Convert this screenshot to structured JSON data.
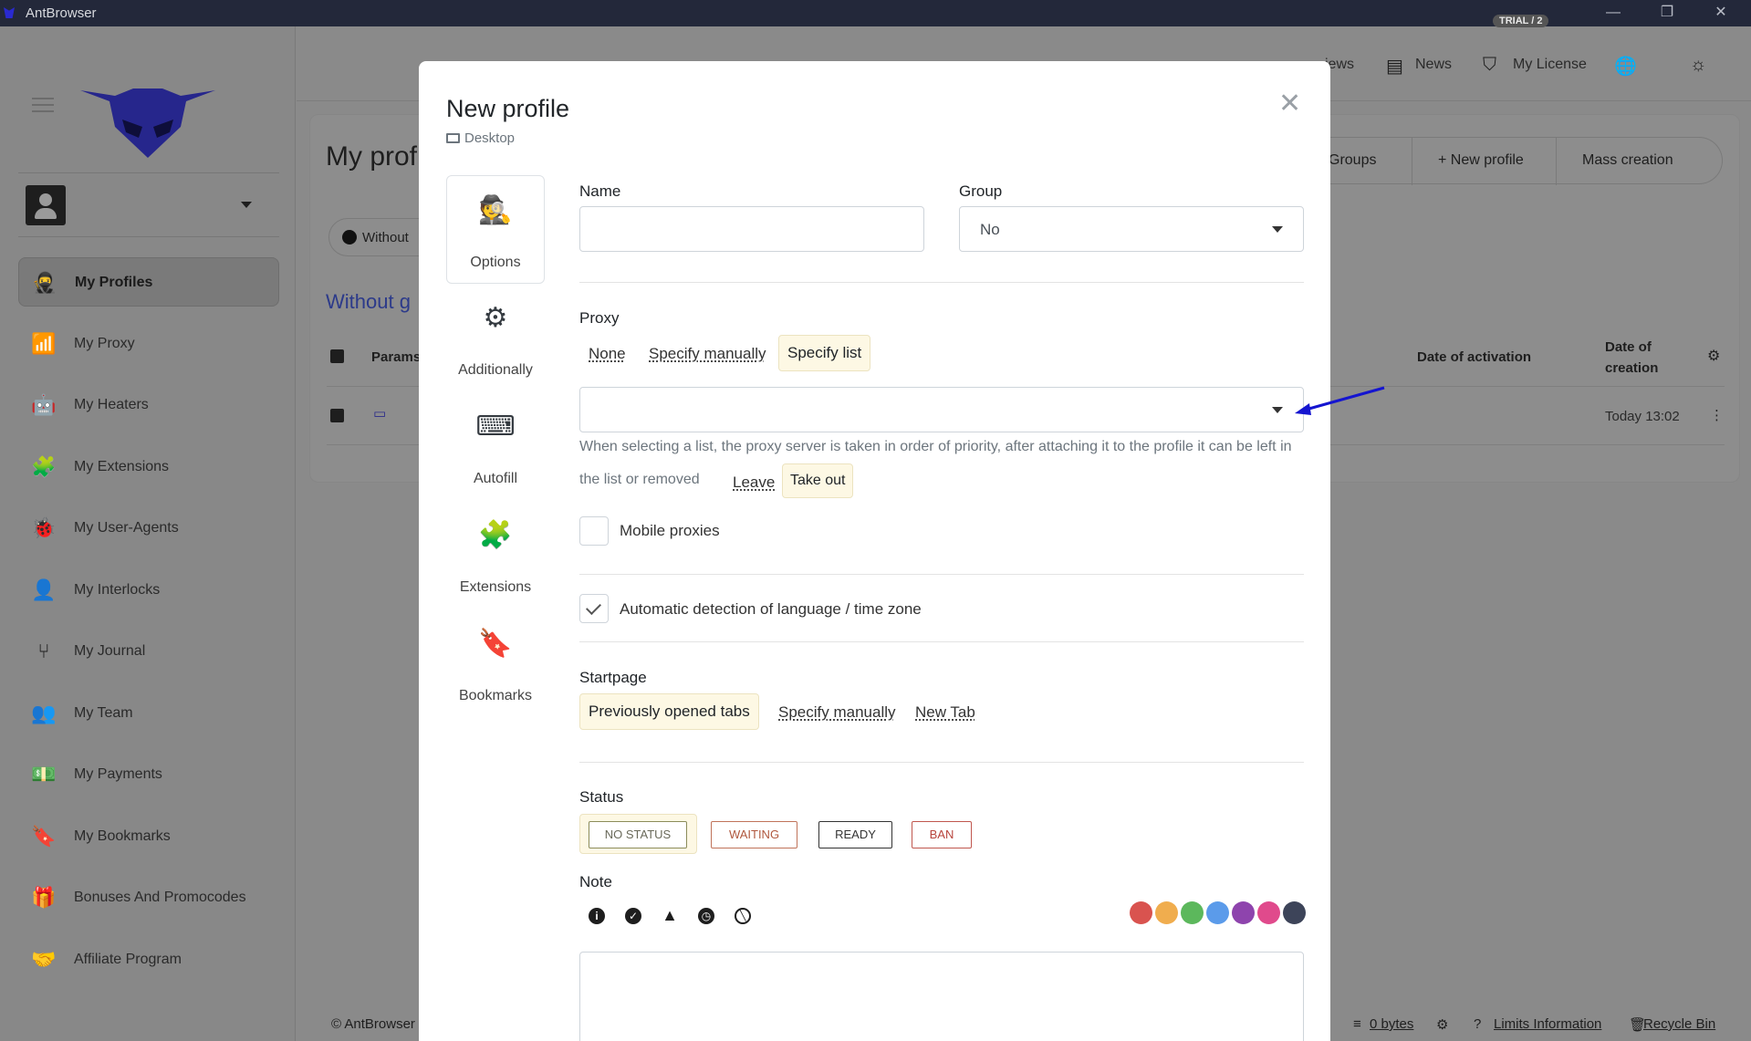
{
  "window": {
    "title": "AntBrowser",
    "minimize": "—",
    "restore": "❐",
    "close": "✕"
  },
  "sidebar": {
    "items": [
      {
        "label": "My Profiles",
        "icon": "profile-mask-icon",
        "glyph": "🥷",
        "active": true
      },
      {
        "label": "My Proxy",
        "icon": "wifi-icon",
        "glyph": "📶"
      },
      {
        "label": "My Heaters",
        "icon": "robot-icon",
        "glyph": "🤖"
      },
      {
        "label": "My Extensions",
        "icon": "puzzle-icon",
        "glyph": "🧩"
      },
      {
        "label": "My User-Agents",
        "icon": "bug-icon",
        "glyph": "🐞"
      },
      {
        "label": "My Interlocks",
        "icon": "user-lock-icon",
        "glyph": "👤"
      },
      {
        "label": "My Journal",
        "icon": "branch-icon",
        "glyph": "⑂"
      },
      {
        "label": "My Team",
        "icon": "users-icon",
        "glyph": "👥"
      },
      {
        "label": "My Payments",
        "icon": "money-icon",
        "glyph": "💵"
      },
      {
        "label": "My Bookmarks",
        "icon": "bookmark-icon",
        "glyph": "🔖"
      },
      {
        "label": "Bonuses And Promocodes",
        "icon": "gift-icon",
        "glyph": "🎁"
      },
      {
        "label": "Affiliate Program",
        "icon": "handshake-icon",
        "glyph": "🤝"
      }
    ]
  },
  "topbar": {
    "news": "News",
    "license": "My License",
    "trial_badge": "TRIAL / 2",
    "reviews": "iews"
  },
  "background": {
    "page_title": "My prof",
    "filter_chip": "Without",
    "group_heading": "Without g",
    "col_params": "Params",
    "col_activation": "Date of activation",
    "col_creation_1": "Date of",
    "col_creation_2": "creation",
    "row_creation": "Today 13:02",
    "btn_groups": "Groups",
    "btn_new_profile": "+ New profile",
    "btn_mass_creation": "Mass creation",
    "footer_copy": "© AntBrowser",
    "footer_bytes": "0 bytes",
    "footer_limits": "Limits Information",
    "footer_recycle": "Recycle Bin"
  },
  "modal": {
    "title": "New profile",
    "subtitle": "Desktop",
    "tabs": [
      {
        "label": "Options",
        "icon": "incognito-icon",
        "glyph": "🕵",
        "active": true
      },
      {
        "label": "Additionally",
        "icon": "gears-icon",
        "glyph": "⚙"
      },
      {
        "label": "Autofill",
        "icon": "keyboard-icon",
        "glyph": "⌨"
      },
      {
        "label": "Extensions",
        "icon": "puzzle-icon",
        "glyph": "🧩"
      },
      {
        "label": "Bookmarks",
        "icon": "bookmark-outline-icon",
        "glyph": "🔖"
      }
    ],
    "name_label": "Name",
    "name_value": "",
    "group_label": "Group",
    "group_value": "No",
    "proxy_label": "Proxy",
    "proxy_none": "None",
    "proxy_manual": "Specify manually",
    "proxy_list": "Specify list",
    "proxy_list_value": "",
    "proxy_hint": "When selecting a list, the proxy server is taken in order of priority, after attaching it to the profile it can be left in the list or removed",
    "leave": "Leave",
    "take_out": "Take out",
    "mobile_proxies": "Mobile proxies",
    "auto_detect": "Automatic detection of language / time zone",
    "startpage_label": "Startpage",
    "start_prev": "Previously opened tabs",
    "start_manual": "Specify manually",
    "start_newtab": "New Tab",
    "status_label": "Status",
    "status": {
      "none": "NO STATUS",
      "waiting": "WAITING",
      "ready": "READY",
      "ban": "BAN"
    },
    "note_label": "Note",
    "note_value": "",
    "note_icons": [
      {
        "icon": "info-icon",
        "glyph": "i"
      },
      {
        "icon": "check-circle-icon",
        "glyph": "✓"
      },
      {
        "icon": "warning-icon",
        "glyph": "!"
      },
      {
        "icon": "clock-icon",
        "glyph": "◷"
      },
      {
        "icon": "ban-icon",
        "glyph": "⊘"
      }
    ],
    "colors": [
      "#d9534f",
      "#f0ad4e",
      "#5cb85c",
      "#5b9bea",
      "#8e44ad",
      "#e04a8c",
      "#3d4459"
    ]
  }
}
